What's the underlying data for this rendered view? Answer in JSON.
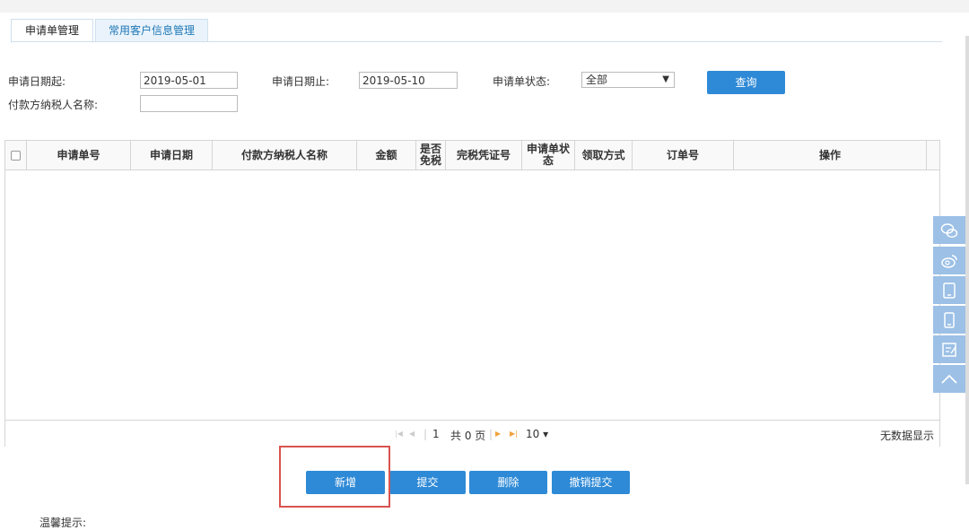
{
  "tabs": [
    {
      "label": "申请单管理",
      "active": true
    },
    {
      "label": "常用客户信息管理",
      "active": false
    }
  ],
  "search": {
    "start_date_label": "申请日期起:",
    "start_date_value": "2019-05-01",
    "end_date_label": "申请日期止:",
    "end_date_value": "2019-05-10",
    "status_label": "申请单状态:",
    "status_value": "全部",
    "payer_label": "付款方纳税人名称:",
    "payer_value": "",
    "query_button": "查询"
  },
  "table": {
    "columns": [
      "申请单号",
      "申请日期",
      "付款方纳税人名称",
      "金额",
      "是否\n免税",
      "完税凭证号",
      "申请单状\n态",
      "领取方式",
      "订单号",
      "操作"
    ],
    "rows": []
  },
  "pager": {
    "page": "1",
    "total_pages": "共 0 页",
    "page_size": "10 ▾",
    "empty_text": "无数据显示"
  },
  "actions": {
    "add": "新增",
    "submit": "提交",
    "delete": "删除",
    "withdraw": "撤销提交"
  },
  "tip_partial": "温馨提示:",
  "side_icons": [
    "wechat-icon",
    "weibo-icon",
    "tablet-icon",
    "phone-icon",
    "feedback-icon",
    "back-to-top-icon"
  ],
  "colors": {
    "accent": "#2e8ad6",
    "highlight_box": "#d9534f",
    "side_bar": "#9cc0e6"
  }
}
